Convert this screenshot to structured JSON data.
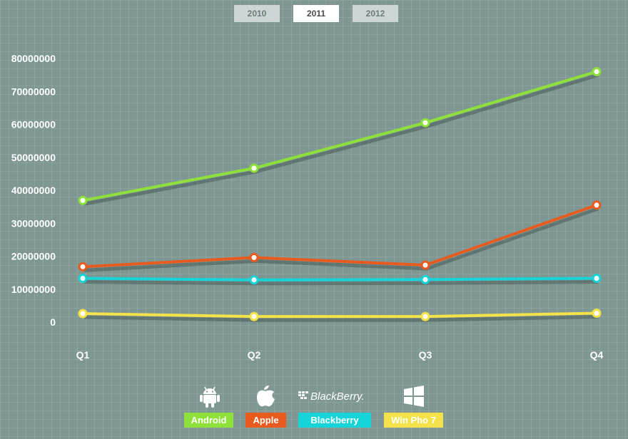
{
  "year_tabs": [
    {
      "label": "2010",
      "active": false
    },
    {
      "label": "2011",
      "active": true
    },
    {
      "label": "2012",
      "active": false
    }
  ],
  "chart_data": {
    "type": "line",
    "categories": [
      "Q1",
      "Q2",
      "Q3",
      "Q4"
    ],
    "ylim": [
      0,
      80000000
    ],
    "yticks": [
      "0",
      "10000000",
      "20000000",
      "30000000",
      "40000000",
      "50000000",
      "60000000",
      "70000000",
      "80000000"
    ],
    "grid": true,
    "legend_position": "bottom",
    "series": [
      {
        "name": "Android",
        "color": "#8ee03a",
        "values": [
          36900000,
          46700000,
          60500000,
          76000000
        ]
      },
      {
        "name": "Apple",
        "color": "#e85a1e",
        "values": [
          16800000,
          19600000,
          17300000,
          35500000
        ]
      },
      {
        "name": "Blackberry",
        "color": "#16d4d8",
        "values": [
          13300000,
          12800000,
          12900000,
          13300000
        ]
      },
      {
        "name": "Win Pho 7",
        "color": "#f3e24a",
        "values": [
          2600000,
          1700000,
          1700000,
          2700000
        ]
      }
    ]
  },
  "legend": [
    {
      "label": "Android",
      "icon": "android-icon",
      "color": "#8ee03a"
    },
    {
      "label": "Apple",
      "icon": "apple-icon",
      "color": "#e85a1e"
    },
    {
      "label": "Blackberry",
      "icon": "blackberry-logo",
      "color": "#16d4d8",
      "logo_text": "BlackBerry."
    },
    {
      "label": "Win Pho 7",
      "icon": "windows-icon",
      "color": "#f3e24a"
    }
  ]
}
